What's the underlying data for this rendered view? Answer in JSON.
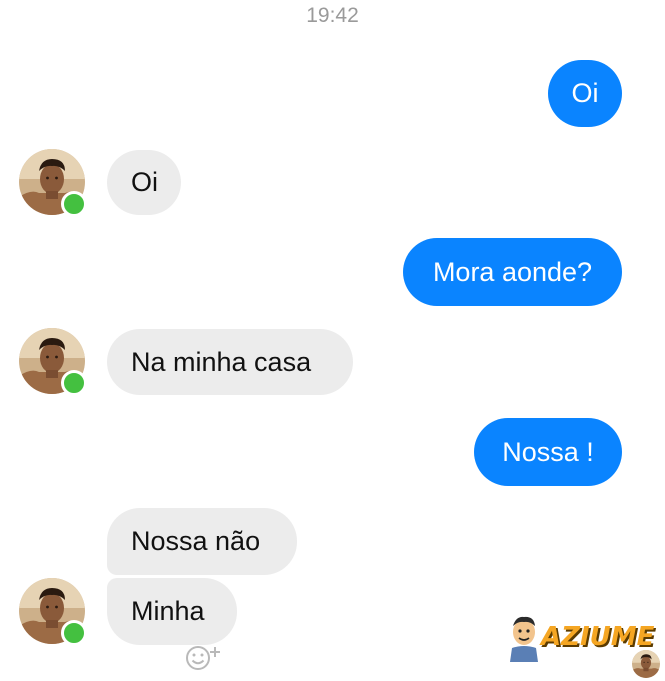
{
  "status_bar": {
    "time": "19:42"
  },
  "messages": [
    {
      "from": "me",
      "text": "Oi"
    },
    {
      "from": "contact",
      "text": "Oi"
    },
    {
      "from": "me",
      "text": "Mora aonde?"
    },
    {
      "from": "contact",
      "text": "Na minha casa"
    },
    {
      "from": "me",
      "text": "Nossa !"
    },
    {
      "from": "contact",
      "text": "Nossa não"
    },
    {
      "from": "contact",
      "text": "Minha"
    }
  ],
  "contact": {
    "online": true,
    "avatar": "contact-avatar-photo"
  },
  "icons": {
    "reaction": "smiley-add-icon"
  },
  "watermark": {
    "text": "AZIUME"
  },
  "colors": {
    "outgoing_bubble": "#0a84ff",
    "incoming_bubble": "#ececec",
    "online_dot": "#44c040",
    "watermark": "#f5a623"
  }
}
